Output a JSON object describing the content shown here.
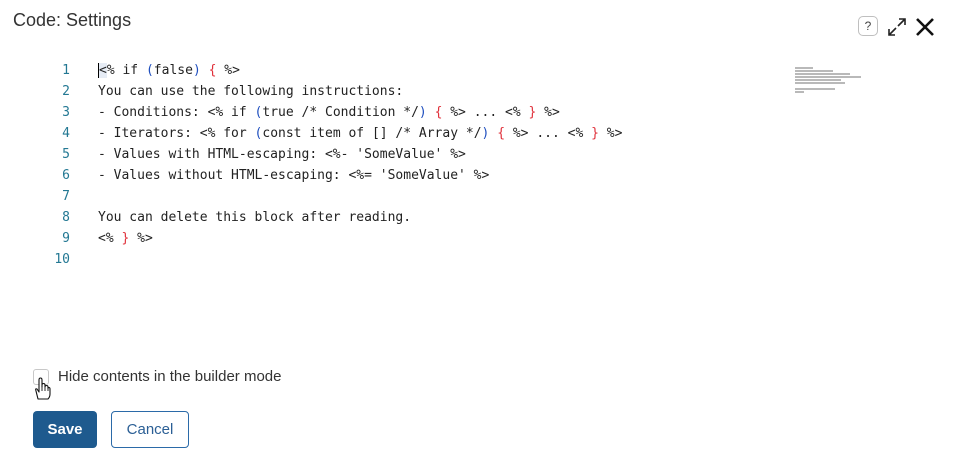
{
  "window": {
    "title": "Code: Settings"
  },
  "toolbar": {
    "help_icon": "help-icon",
    "expand_icon": "expand-icon",
    "close_icon": "close-icon"
  },
  "editor": {
    "lines": [
      {
        "n": "1",
        "parts": [
          {
            "t": "<% if ",
            "c": "plain"
          },
          {
            "t": "(",
            "c": "paren"
          },
          {
            "t": "false",
            "c": "plain"
          },
          {
            "t": ")",
            "c": "paren"
          },
          {
            "t": " ",
            "c": "plain"
          },
          {
            "t": "{",
            "c": "brace"
          },
          {
            "t": " %>",
            "c": "plain"
          }
        ]
      },
      {
        "n": "2",
        "parts": [
          {
            "t": "You can use the following instructions:",
            "c": "plain"
          }
        ]
      },
      {
        "n": "3",
        "parts": [
          {
            "t": "- Conditions: <% if ",
            "c": "plain"
          },
          {
            "t": "(",
            "c": "paren"
          },
          {
            "t": "true /* Condition */",
            "c": "plain"
          },
          {
            "t": ")",
            "c": "paren"
          },
          {
            "t": " ",
            "c": "plain"
          },
          {
            "t": "{",
            "c": "brace"
          },
          {
            "t": " %> ... <% ",
            "c": "plain"
          },
          {
            "t": "}",
            "c": "brace"
          },
          {
            "t": " %>",
            "c": "plain"
          }
        ]
      },
      {
        "n": "4",
        "parts": [
          {
            "t": "- Iterators: <% for ",
            "c": "plain"
          },
          {
            "t": "(",
            "c": "paren"
          },
          {
            "t": "const item of [] /* Array */",
            "c": "plain"
          },
          {
            "t": ")",
            "c": "paren"
          },
          {
            "t": " ",
            "c": "plain"
          },
          {
            "t": "{",
            "c": "brace"
          },
          {
            "t": " %> ... <% ",
            "c": "plain"
          },
          {
            "t": "}",
            "c": "brace"
          },
          {
            "t": " %>",
            "c": "plain"
          }
        ]
      },
      {
        "n": "5",
        "parts": [
          {
            "t": "- Values with HTML-escaping: <%- 'SomeValue' %>",
            "c": "plain"
          }
        ]
      },
      {
        "n": "6",
        "parts": [
          {
            "t": "- Values without HTML-escaping: <%= 'SomeValue' %>",
            "c": "plain"
          }
        ]
      },
      {
        "n": "7",
        "parts": []
      },
      {
        "n": "8",
        "parts": [
          {
            "t": "You can delete this block after reading.",
            "c": "plain"
          }
        ]
      },
      {
        "n": "9",
        "parts": [
          {
            "t": "<% ",
            "c": "plain"
          },
          {
            "t": "}",
            "c": "brace"
          },
          {
            "t": " %>",
            "c": "plain"
          }
        ]
      },
      {
        "n": "10",
        "parts": []
      }
    ]
  },
  "options": {
    "hide_contents_label": "Hide contents in the builder mode",
    "hide_contents_checked": false
  },
  "actions": {
    "save_label": "Save",
    "cancel_label": "Cancel"
  },
  "colors": {
    "primary": "#1e5a8e",
    "line_number": "#237893",
    "brace": "#e0303a",
    "paren": "#1f4fbf"
  }
}
